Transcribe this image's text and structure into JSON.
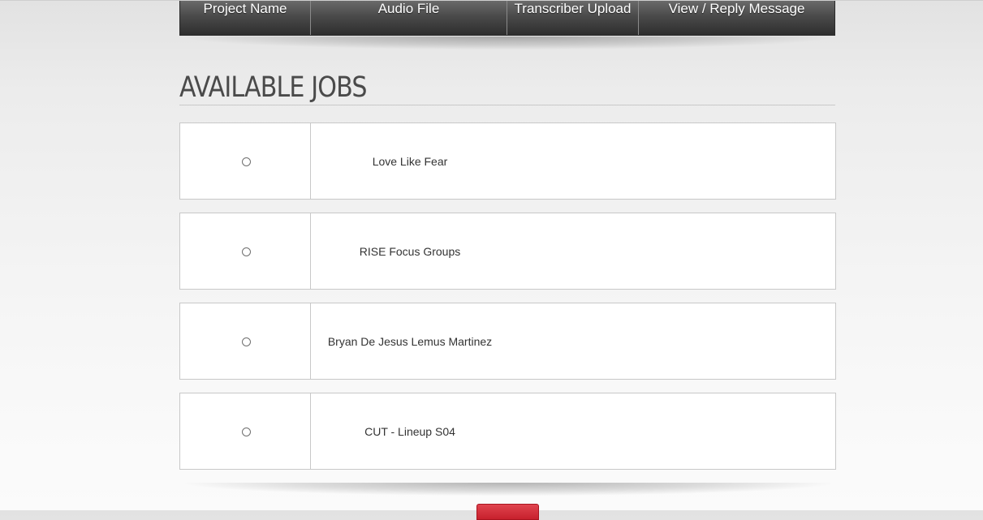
{
  "header": {
    "columns": [
      "Project Name",
      "Audio File",
      "Transcriber Upload",
      "View / Reply Message"
    ]
  },
  "section": {
    "title": "AVAILABLE JOBS"
  },
  "jobs": [
    {
      "name": "Love Like Fear",
      "selected": false
    },
    {
      "name": "RISE Focus Groups",
      "selected": false
    },
    {
      "name": "Bryan De Jesus Lemus Martinez",
      "selected": false
    },
    {
      "name": "CUT - Lineup S04",
      "selected": false
    }
  ],
  "colors": {
    "header_bg": "#4a4a4a",
    "header_text": "#ffffff",
    "button_red": "#d12f3b"
  }
}
